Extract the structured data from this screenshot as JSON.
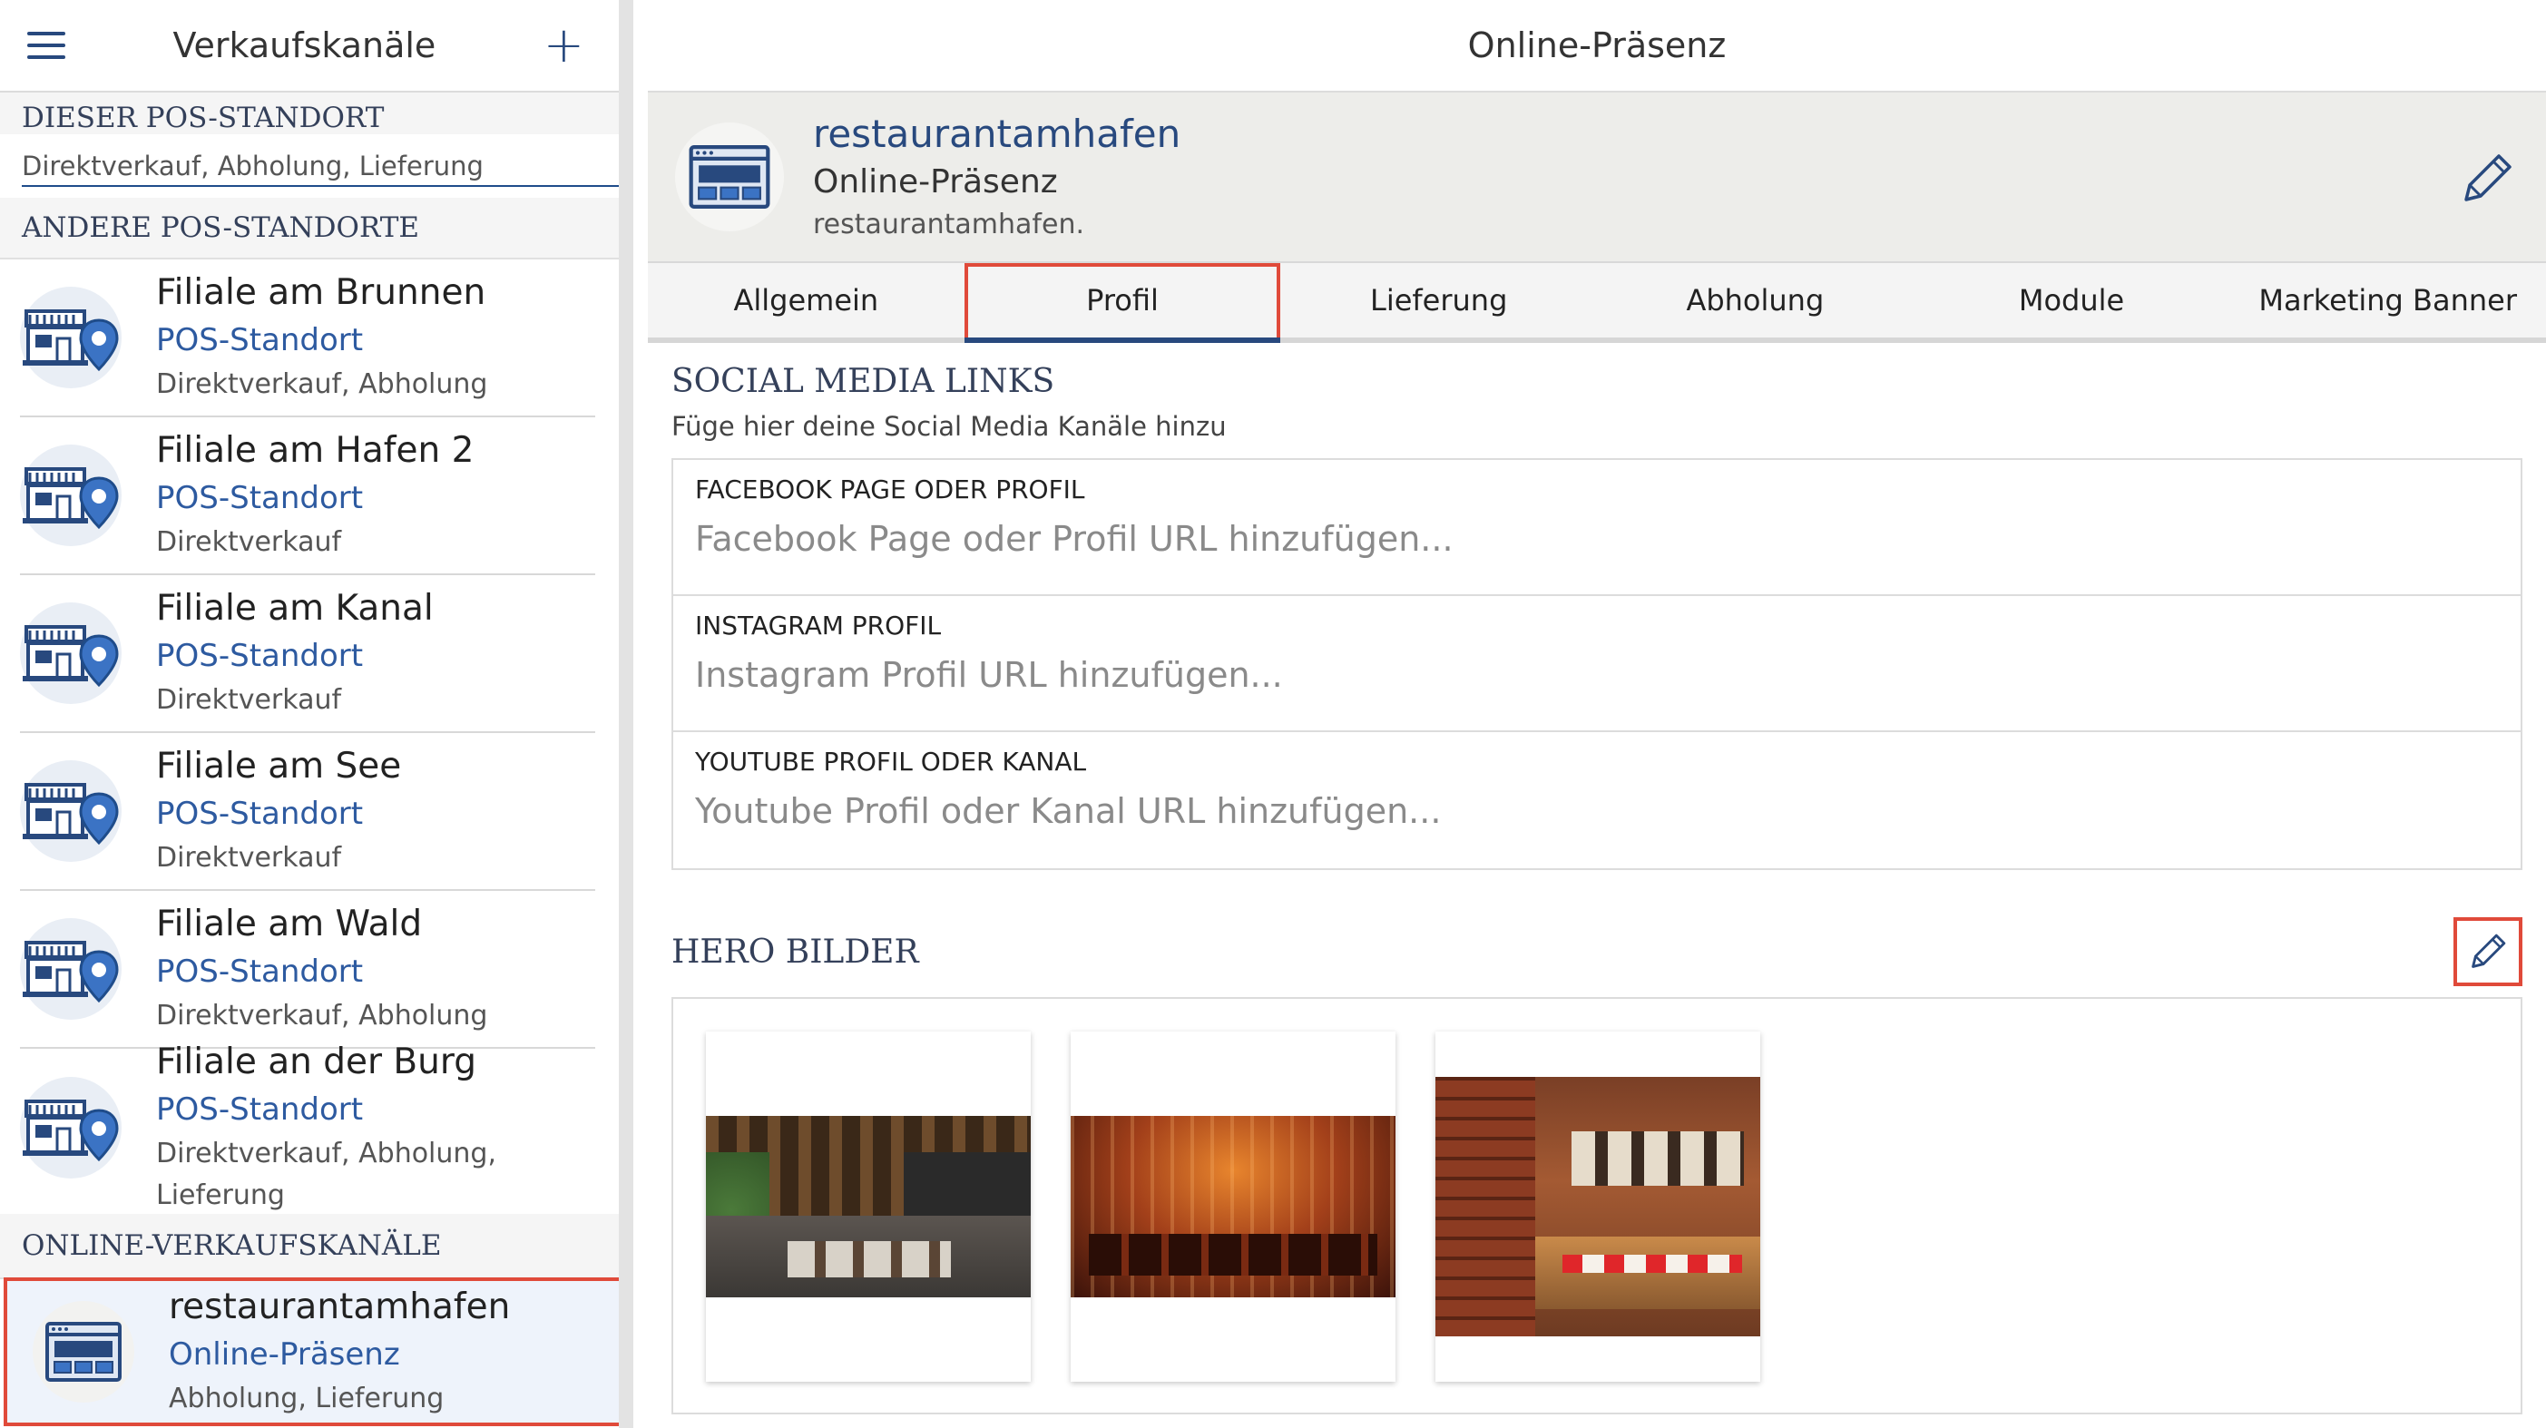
{
  "sidebar": {
    "title": "Verkaufskanäle",
    "sections": {
      "this_pos": "DIESER POS-STANDORT",
      "other_pos": "ANDERE POS-STANDORTE",
      "online": "ONLINE-VERKAUFSKANÄLE"
    },
    "this_pos_partial": "Direktverkauf, Abholung, Lieferung",
    "locations": [
      {
        "name": "Filiale am Brunnen",
        "type": "POS-Standort",
        "desc": "Direktverkauf, Abholung"
      },
      {
        "name": "Filiale am Hafen 2",
        "type": "POS-Standort",
        "desc": "Direktverkauf"
      },
      {
        "name": "Filiale am Kanal",
        "type": "POS-Standort",
        "desc": "Direktverkauf"
      },
      {
        "name": "Filiale am See",
        "type": "POS-Standort",
        "desc": "Direktverkauf"
      },
      {
        "name": "Filiale am Wald",
        "type": "POS-Standort",
        "desc": "Direktverkauf, Abholung"
      },
      {
        "name": "Filiale an der Burg",
        "type": "POS-Standort",
        "desc": "Direktverkauf, Abholung, Lieferung"
      }
    ],
    "online_item": {
      "name": "restaurantamhafen",
      "type": "Online-Präsenz",
      "desc": "Abholung, Lieferung"
    }
  },
  "main": {
    "title": "Online-Präsenz",
    "profile": {
      "name": "restaurantamhafen",
      "type": "Online-Präsenz",
      "url": "restaurantamhafen."
    },
    "tabs": [
      "Allgemein",
      "Profil",
      "Lieferung",
      "Abholung",
      "Module",
      "Marketing Banner"
    ],
    "active_tab": "Profil",
    "social": {
      "title": "SOCIAL MEDIA LINKS",
      "subtitle": "Füge hier deine Social Media Kanäle hinzu",
      "fields": [
        {
          "label": "FACEBOOK PAGE ODER PROFIL",
          "placeholder": "Facebook Page oder Profil URL hinzufügen...",
          "value": ""
        },
        {
          "label": "INSTAGRAM PROFIL",
          "placeholder": "Instagram Profil URL hinzufügen...",
          "value": ""
        },
        {
          "label": "YOUTUBE PROFIL ODER KANAL",
          "placeholder": "Youtube Profil oder Kanal URL hinzufügen...",
          "value": ""
        }
      ]
    },
    "hero": {
      "title": "HERO BILDER"
    }
  },
  "colors": {
    "accent": "#28497e",
    "link": "#2d5aa0",
    "highlight": "#e04a3a",
    "profile_bg": "#ededea"
  },
  "icons": {
    "menu": "hamburger-icon",
    "add": "plus-icon",
    "store": "store-location-icon",
    "web": "browser-window-icon",
    "edit": "pencil-icon"
  }
}
